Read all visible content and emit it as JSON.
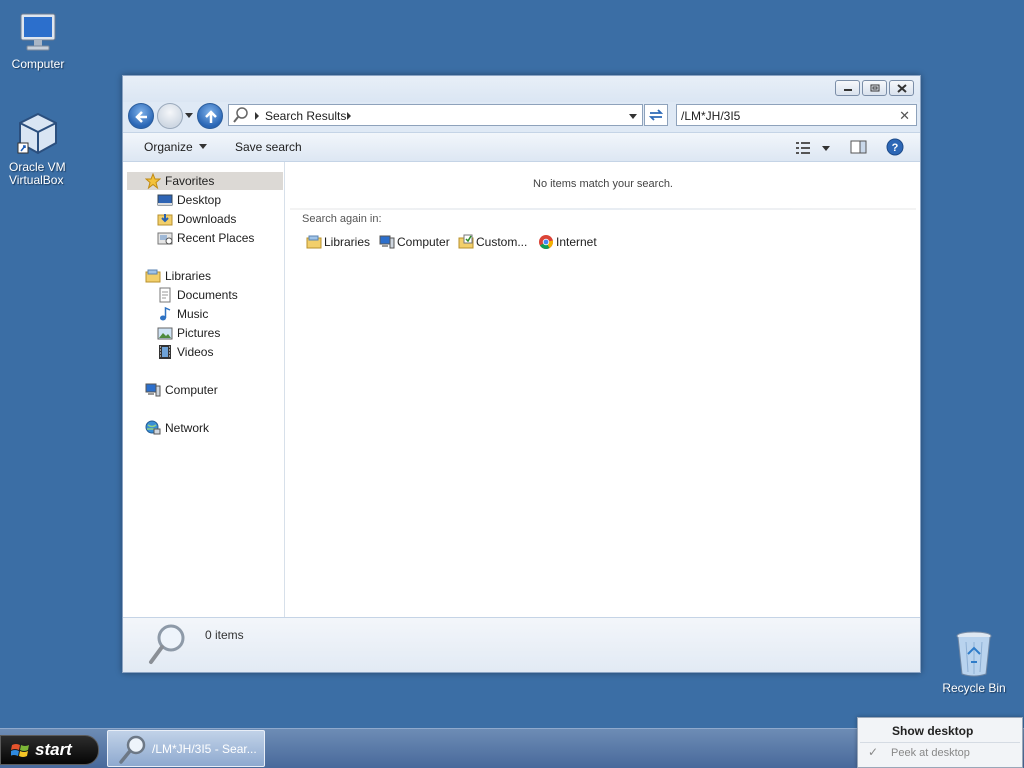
{
  "desktop": {
    "icons": [
      {
        "label": "Computer",
        "icon": "computer-icon"
      },
      {
        "label": "Oracle VM VirtualBox",
        "icon": "virtualbox-icon"
      },
      {
        "label": "Recycle Bin",
        "icon": "recycle-bin-icon"
      }
    ]
  },
  "window": {
    "address": {
      "crumb": "Search Results"
    },
    "search": {
      "value": "/LM*JH/3I5"
    },
    "toolbar": {
      "organize": "Organize",
      "save_search": "Save search"
    },
    "navpane": {
      "favorites": {
        "label": "Favorites",
        "items": [
          "Desktop",
          "Downloads",
          "Recent Places"
        ]
      },
      "libraries": {
        "label": "Libraries",
        "items": [
          "Documents",
          "Music",
          "Pictures",
          "Videos"
        ]
      },
      "computer": "Computer",
      "network": "Network"
    },
    "content": {
      "no_items": "No items match your search.",
      "search_again": "Search again in:",
      "locations": [
        "Libraries",
        "Computer",
        "Custom...",
        "Internet"
      ]
    },
    "details": {
      "count": "0 items"
    }
  },
  "taskbar": {
    "start": "start",
    "task_title": "/LM*JH/3I5 - Sear..."
  },
  "popup": {
    "show_desktop": "Show desktop",
    "peek_at_desktop": "Peek at desktop"
  }
}
